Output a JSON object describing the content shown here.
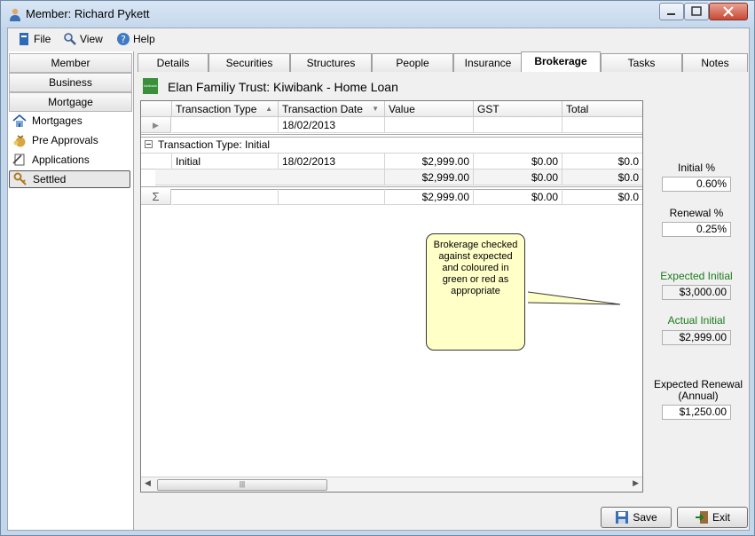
{
  "window": {
    "title": "Member: Richard Pykett"
  },
  "menu": {
    "file": "File",
    "view": "View",
    "help": "Help"
  },
  "sidebar": {
    "buttons": [
      "Member",
      "Business",
      "Mortgage"
    ],
    "items": [
      {
        "label": "Mortgages",
        "icon": "house-icon"
      },
      {
        "label": "Pre Approvals",
        "icon": "money-bag-icon"
      },
      {
        "label": "Applications",
        "icon": "document-icon"
      },
      {
        "label": "Settled",
        "icon": "key-icon",
        "selected": true
      }
    ]
  },
  "tabs": [
    "Details",
    "Securities",
    "Structures",
    "People",
    "Insurance",
    "Brokerage",
    "Tasks",
    "Notes"
  ],
  "active_tab": "Brokerage",
  "header": {
    "logo_text": "kiwibank",
    "title": "Elan Familiy Trust: Kiwibank - Home Loan"
  },
  "grid": {
    "columns": [
      "Transaction Type",
      "Transaction Date",
      "Value",
      "GST",
      "Total"
    ],
    "new_row": {
      "date": "18/02/2013"
    },
    "group_label": "Transaction Type:  Initial",
    "rows": [
      {
        "type": "Initial",
        "date": "18/02/2013",
        "value": "$2,999.00",
        "gst": "$0.00",
        "total": "$0.0"
      }
    ],
    "group_summary": {
      "value": "$2,999.00",
      "gst": "$0.00",
      "total": "$0.0"
    },
    "grand_summary": {
      "symbol": "Σ",
      "value": "$2,999.00",
      "gst": "$0.00",
      "total": "$0.0"
    }
  },
  "note": "Brokerage checked against expected and coloured in green or red as appropriate",
  "right_panel": {
    "initial_pct_label": "Initial %",
    "initial_pct": "0.60%",
    "renewal_pct_label": "Renewal %",
    "renewal_pct": "0.25%",
    "expected_initial_label": "Expected Initial",
    "expected_initial": "$3,000.00",
    "actual_initial_label": "Actual Initial",
    "actual_initial": "$2,999.00",
    "expected_renewal_label": "Expected Renewal (Annual)",
    "expected_renewal": "$1,250.00"
  },
  "footer": {
    "save": "Save",
    "exit": "Exit"
  },
  "colors": {
    "status_green": "#1b7a1b",
    "note_fill": "#ffffc8",
    "frame": "#c3d6ea"
  }
}
